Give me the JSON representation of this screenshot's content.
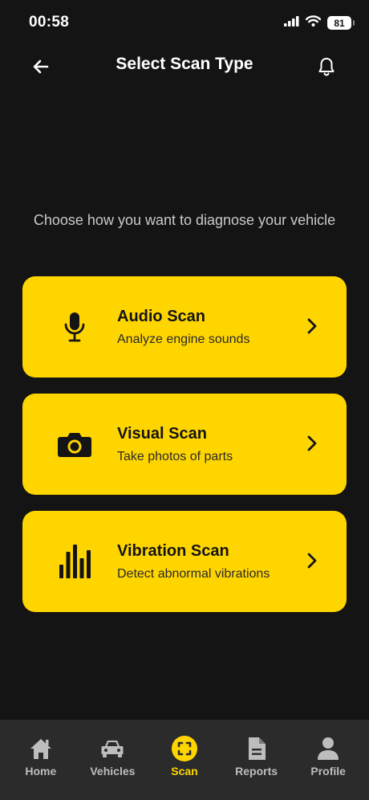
{
  "status_bar": {
    "time": "00:58",
    "battery": "81"
  },
  "header": {
    "title": "Select Scan Type"
  },
  "subtitle": "Choose how you want to diagnose your vehicle",
  "cards": [
    {
      "title": "Audio Scan",
      "description": "Analyze engine sounds",
      "icon": "microphone-icon"
    },
    {
      "title": "Visual Scan",
      "description": "Take photos of parts",
      "icon": "camera-icon"
    },
    {
      "title": "Vibration Scan",
      "description": "Detect abnormal vibrations",
      "icon": "bar-chart-icon"
    }
  ],
  "nav": [
    {
      "label": "Home",
      "icon": "home-icon"
    },
    {
      "label": "Vehicles",
      "icon": "car-icon"
    },
    {
      "label": "Scan",
      "icon": "scan-icon",
      "active": true
    },
    {
      "label": "Reports",
      "icon": "document-icon"
    },
    {
      "label": "Profile",
      "icon": "person-icon"
    }
  ],
  "colors": {
    "background": "#141414",
    "accent": "#FFD500",
    "nav_background": "#2b2b2b",
    "nav_inactive": "#bdbdbd"
  }
}
